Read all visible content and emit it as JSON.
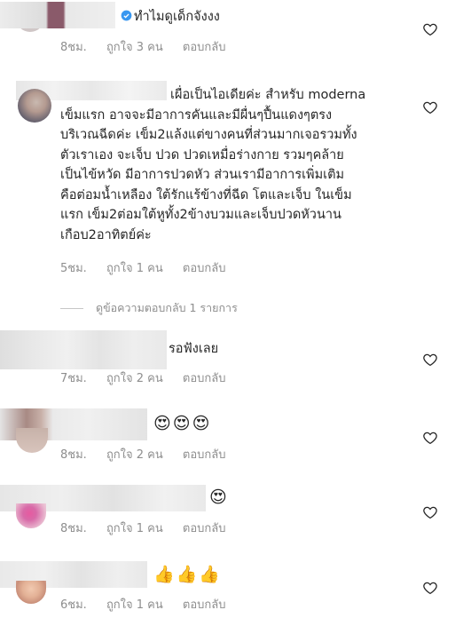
{
  "comments": [
    {
      "text": "ทำไมดูเด็กจังงง",
      "verified": true,
      "time": "8ชม.",
      "likes": "ถูกใจ 3 คน",
      "reply": "ตอบกลับ"
    },
    {
      "lines": [
        "เผื่อเป็นไอเดียค่ะ สำหรับ moderna",
        "เข็มแรก อาจจะมีอาการคันและมีผื่นๆปื้นแดงๆตรง",
        "บริเวณฉีดค่ะ เข็ม2แล้งแต่ขางคนที่ส่วนมากเจอรวมทั้ง",
        "ตัวเราเอง จะเจ็บ ปวด ปวดเหมื่อร่างกาย รวมๆคล้าย",
        "เป็นไข้หวัด มีอาการปวดหัว ส่วนเรามีอาการเพิ่มเติม",
        "คือต่อมน้ำเหลือง ใต้รักแร้ข้างที่ฉีด โตและเจ็บ ในเข็ม",
        "แรก เข็ม2ต่อมใต้หูทั้ง2ข้างบวมและเจ็บปวดหัวนาน",
        "เกือบ2อาทิตย์ค่ะ"
      ],
      "time": "5ชม.",
      "likes": "ถูกใจ 1 คน",
      "reply": "ตอบกลับ",
      "view_replies": "ดูข้อความตอบกลับ 1 รายการ"
    },
    {
      "text": "รอฟังเลย",
      "time": "7ชม.",
      "likes": "ถูกใจ 2 คน",
      "reply": "ตอบกลับ"
    },
    {
      "text": "😍😍😍",
      "time": "8ชม.",
      "likes": "ถูกใจ 2 คน",
      "reply": "ตอบกลับ"
    },
    {
      "text": "😍",
      "time": "8ชม.",
      "likes": "ถูกใจ 1 คน",
      "reply": "ตอบกลับ"
    },
    {
      "text": "👍👍👍",
      "time": "6ชม.",
      "likes": "ถูกใจ 1 คน",
      "reply": "ตอบกลับ"
    }
  ],
  "icons": {
    "like": "heart-outline-icon",
    "verified": "verified-badge-icon"
  },
  "colors": {
    "text": "#262626",
    "meta": "#8e8e8e",
    "verified": "#3897f0"
  }
}
